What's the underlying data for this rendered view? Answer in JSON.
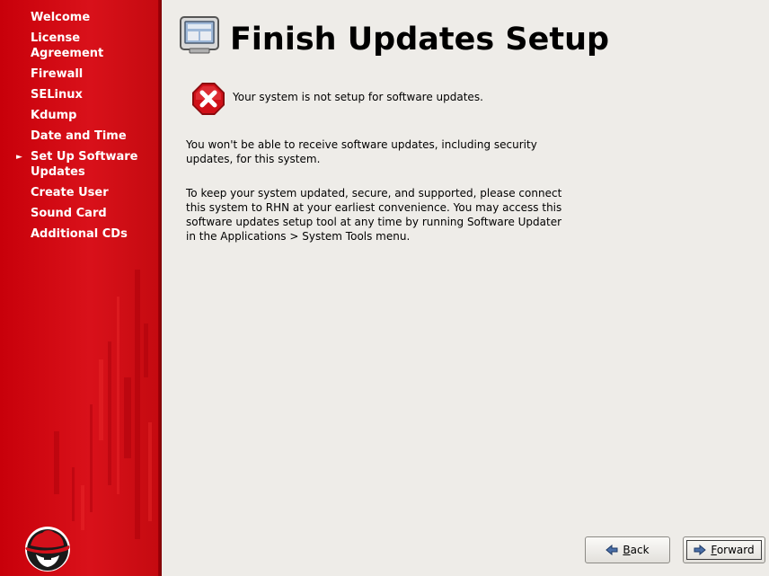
{
  "sidebar": {
    "items": [
      {
        "label": "Welcome"
      },
      {
        "label": "License Agreement"
      },
      {
        "label": "Firewall"
      },
      {
        "label": "SELinux"
      },
      {
        "label": "Kdump"
      },
      {
        "label": "Date and Time"
      },
      {
        "label": "Set Up Software Updates",
        "current": true
      },
      {
        "label": "Create User"
      },
      {
        "label": "Sound Card"
      },
      {
        "label": "Additional CDs"
      }
    ]
  },
  "main": {
    "title": "Finish Updates Setup",
    "error_message": "Your system is not setup for software updates.",
    "paragraph1": "You won't be able to receive software updates, including security updates, for this system.",
    "paragraph2": "To keep your system updated, secure, and supported, please connect this system to RHN at your earliest convenience. You may access this software updates setup tool at any time by running Software Updater in the Applications > System Tools menu."
  },
  "buttons": {
    "back": {
      "mnemonic": "B",
      "rest": "ack"
    },
    "forward": {
      "mnemonic": "F",
      "rest": "orward"
    }
  },
  "icons": {
    "header": "computer-update-icon",
    "error": "error-stop-icon",
    "back": "arrow-left-icon",
    "forward": "arrow-right-icon",
    "logo": "redhat-shadowman-logo"
  },
  "colors": {
    "sidebar_red": "#d9111a",
    "error_red": "#d01018",
    "background": "#eeece8"
  }
}
